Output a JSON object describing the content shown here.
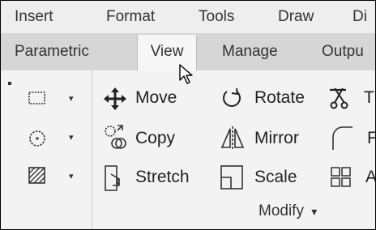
{
  "menu": {
    "insert": "Insert",
    "format": "Format",
    "tools": "Tools",
    "draw": "Draw",
    "dim_partial": "Di"
  },
  "tabs": {
    "parametric": "Parametric",
    "view": "View",
    "manage": "Manage",
    "output_partial": "Outpu"
  },
  "modify": {
    "move": "Move",
    "rotate": "Rotate",
    "trim_partial": "T",
    "copy": "Copy",
    "mirror": "Mirror",
    "fillet_partial": "F",
    "stretch": "Stretch",
    "scale": "Scale",
    "array_partial": "A",
    "panel_title": "Modify",
    "dropdown_arrow": "▾"
  },
  "icons": {
    "rectangle": "rectangle-icon",
    "circle": "circle-icon",
    "hatch": "hatch-icon",
    "move": "move-icon",
    "copy": "copy-icon",
    "stretch": "stretch-icon",
    "rotate": "rotate-icon",
    "mirror": "mirror-icon",
    "scale": "scale-icon",
    "trim": "trim-icon",
    "fillet": "fillet-icon",
    "array": "array-icon",
    "cursor": "mouse-pointer-icon"
  },
  "colors": {
    "menu_bg": "#eeeeee",
    "tab_bg": "#d6d6d6",
    "panel_bg": "#f3f3f3",
    "active_tab_bg": "#f6f6f6"
  }
}
